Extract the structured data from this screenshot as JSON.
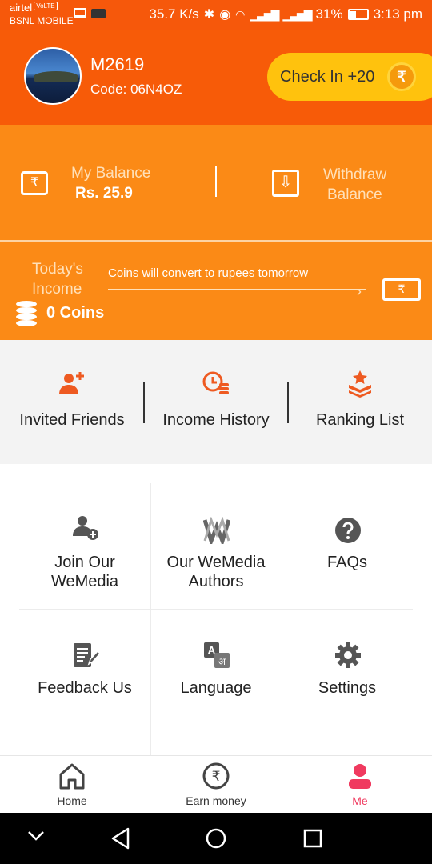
{
  "status_bar": {
    "carrier_primary": "airtel",
    "volte": "VoLTE",
    "carrier_secondary": "BSNL MOBILE",
    "speed": "35.7 K/s",
    "battery": "31%",
    "time": "3:13 pm"
  },
  "profile": {
    "username": "M2619",
    "code": "Code: 06N4OZ",
    "checkin_label": "Check In +20",
    "coin_symbol": "₹"
  },
  "balance": {
    "my_balance_label": "My Balance",
    "my_balance_value": "Rs. 25.9",
    "withdraw_label_line1": "Withdraw",
    "withdraw_label_line2": "Balance"
  },
  "income": {
    "label_line1": "Today's",
    "label_line2": "Income",
    "value": "0 Coins",
    "note": "Coins will convert to rupees tomorrow",
    "currency_symbol": "₹"
  },
  "stats": [
    {
      "label": "Invited Friends",
      "icon": "add-user-icon"
    },
    {
      "label": "Income History",
      "icon": "clock-coins-icon"
    },
    {
      "label": "Ranking List",
      "icon": "ranking-star-icon"
    }
  ],
  "grid": [
    {
      "line1": "Join Our",
      "line2": "WeMedia",
      "icon": "add-person-icon"
    },
    {
      "line1": "Our WeMedia",
      "line2": "Authors",
      "icon": "wemedia-logo-icon"
    },
    {
      "line1": "FAQs",
      "line2": "",
      "icon": "question-icon"
    },
    {
      "line1": "Feedback Us",
      "line2": "",
      "icon": "feedback-icon"
    },
    {
      "line1": "Language",
      "line2": "",
      "icon": "translate-icon"
    },
    {
      "line1": "Settings",
      "line2": "",
      "icon": "gear-icon"
    }
  ],
  "bottom_nav": [
    {
      "label": "Home",
      "icon": "home-icon"
    },
    {
      "label": "Earn money",
      "icon": "rupee-icon"
    },
    {
      "label": "Me",
      "icon": "person-icon",
      "active": true
    }
  ],
  "colors": {
    "header": "#f75b08",
    "panel": "#fb8a16",
    "accent": "#ee5a21",
    "active_nav": "#f03a5f",
    "checkin": "#ffc20d"
  }
}
